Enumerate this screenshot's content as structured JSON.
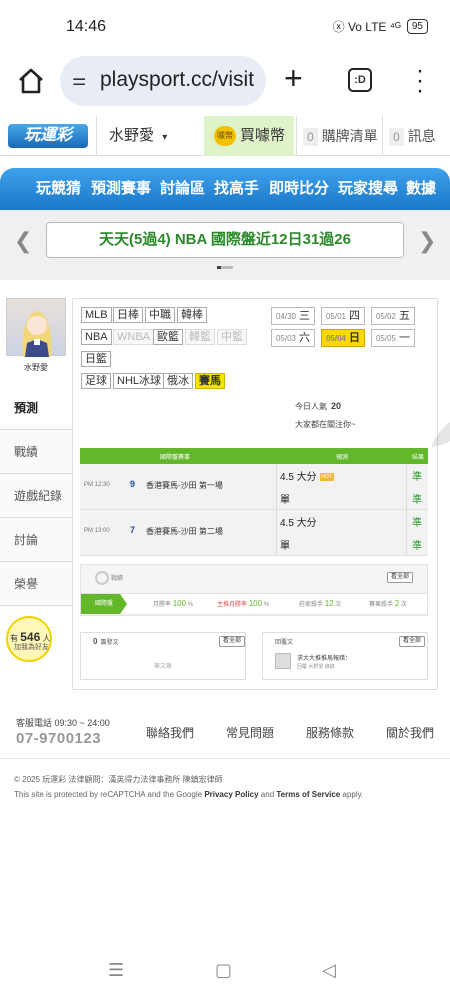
{
  "status_bar": {
    "time": "14:46",
    "signal": "ⓧ Vo LTE ⁴ᴳ",
    "battery": "95"
  },
  "browser": {
    "url": "playsport.cc/visit",
    "tab_count": ":D"
  },
  "site_header": {
    "logo": "玩運彩",
    "user": "水野愛",
    "buy_coin": "買噱幣",
    "coin_icon": "噱幣",
    "cart_count": "0",
    "cart_label": "購牌清單",
    "msg_count": "0",
    "msg_label": "訊息"
  },
  "main_nav": [
    "玩競猜",
    "預測賽事",
    "討論區",
    "找高手",
    "即時比分",
    "玩家搜尋",
    "數據"
  ],
  "marquee": {
    "text": "天天(5過4) NBA 國際盤近12日31過26"
  },
  "profile": {
    "name": "水野愛"
  },
  "sidebar": [
    "預測",
    "戰績",
    "遊戲紀錄",
    "討論",
    "榮譽"
  ],
  "fans": {
    "prefix": "有",
    "count": "546",
    "suffix": "人",
    "label": "加我為好友"
  },
  "leagues": {
    "row1": [
      "MLB",
      "日棒",
      "中職",
      "韓棒"
    ],
    "row2": [
      "NBA",
      "WNBA",
      "歐籃",
      "韓籃",
      "中籃"
    ],
    "row3": [
      "日籃"
    ],
    "row4": [
      "足球",
      "NHL冰球",
      "俄冰",
      "賽馬"
    ]
  },
  "dates": [
    {
      "md": "04/30",
      "wd": "三"
    },
    {
      "md": "05/01",
      "wd": "四"
    },
    {
      "md": "05/02",
      "wd": "五"
    },
    {
      "md": "05/03",
      "wd": "六"
    },
    {
      "md": "05/04",
      "wd": "日"
    },
    {
      "md": "05/05",
      "wd": "一"
    }
  ],
  "today_popularity": {
    "label": "今日人氣",
    "value": "20"
  },
  "watching": "大家都在關注你~",
  "game_table": {
    "headers": [
      "國際盤賽事",
      "預測",
      "結果"
    ],
    "rows": [
      {
        "time": "PM 12:30",
        "no": "9",
        "name": "香港賽馬-沙田 第一場",
        "pick1": "4.5 大分",
        "hot": "HOT",
        "pick2": "單",
        "res1": "準",
        "res2": "準"
      },
      {
        "time": "PM 13:00",
        "no": "7",
        "name": "香港賽馬-沙田 第二場",
        "pick1": "4.5 大分",
        "pick2": "單",
        "res1": "準",
        "res2": "準"
      }
    ]
  },
  "record": {
    "title": "戰績",
    "view_all": "看全部",
    "tab": "國際盤",
    "stats": [
      {
        "label": "月勝率",
        "value": "100",
        "unit": "%"
      },
      {
        "label": "主推月勝率",
        "value": "100",
        "unit": "%"
      },
      {
        "label": "莊家殺手",
        "value": "12",
        "unit": "次"
      },
      {
        "label": "賽果殺手",
        "value": "2",
        "unit": "次"
      }
    ]
  },
  "articles": {
    "count": "0",
    "label": "篇發文",
    "view_all": "看全部",
    "empty": "無文章"
  },
  "replies": {
    "label": "回覆文",
    "view_all": "看全部",
    "title": "求大大推推馬報錯：",
    "sub": "回覆 水野愛 錄錄"
  },
  "footer": {
    "hotline_label": "客服電話 09:30 ~ 24:00",
    "hotline": "07-9700123",
    "links": [
      "聯絡我們",
      "常見問題",
      "服務條款",
      "關於我們"
    ],
    "copyright": "© 2025 玩運彩  法律顧問：漢英得力法律事務所 陳鎮宏律師",
    "captcha_pre": "This site is protected by reCAPTCHA and the Google ",
    "privacy": "Privacy Policy",
    "and": " and ",
    "terms": "Terms of Service",
    "apply": " apply."
  },
  "sys_nav": {
    "menu": "☰",
    "home": "▢",
    "back": "◁"
  }
}
